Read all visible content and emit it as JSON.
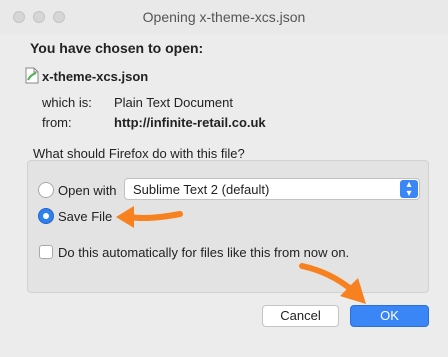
{
  "window": {
    "title": "Opening x-theme-xcs.json"
  },
  "dialog": {
    "heading": "You have chosen to open:",
    "file_name": "x-theme-xcs.json",
    "which_is_label": "which is:",
    "which_is_value": "Plain Text Document",
    "from_label": "from:",
    "from_value": "http://infinite-retail.co.uk",
    "question": "What should Firefox do with this file?",
    "open_with_label": "Open with",
    "open_with_app": "Sublime Text 2 (default)",
    "save_file_label": "Save File",
    "auto_checkbox_label": "Do this automatically for files like this from now on.",
    "selected_action": "Save File",
    "auto_checked": false
  },
  "buttons": {
    "cancel": "Cancel",
    "ok": "OK"
  },
  "colors": {
    "accent": "#3a86f7",
    "annotation_arrow": "#f7811f"
  },
  "icons": {
    "file": "text-file-icon",
    "dropdown": "chevron-updown-icon"
  }
}
